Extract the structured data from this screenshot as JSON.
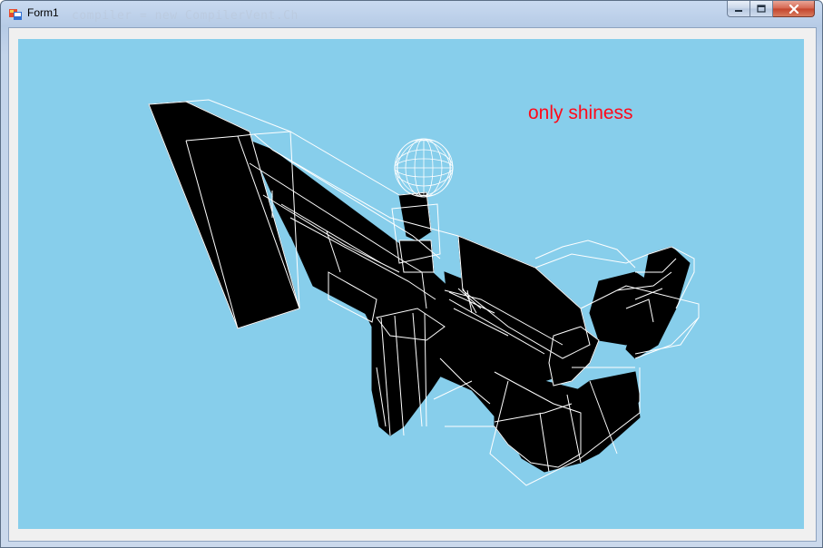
{
  "window": {
    "title": "Form1",
    "background_code_text": "compiler = new CompilerVent.Ch",
    "caption_buttons": [
      "minimize",
      "maximize",
      "close"
    ]
  },
  "viewport": {
    "background_color": "#87ceeb",
    "label": "only shiness",
    "label_color": "#ff0a1a",
    "scene_description_icon": "wireframe-3d-model"
  }
}
